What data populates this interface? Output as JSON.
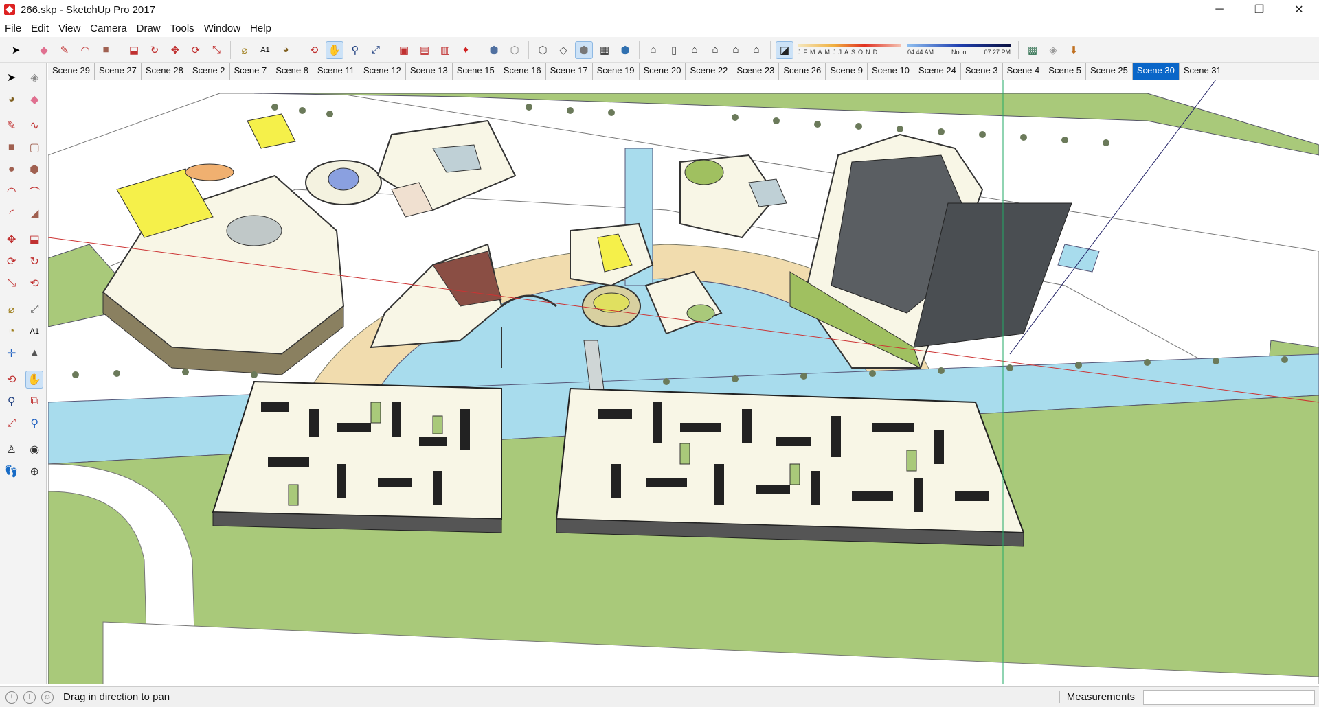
{
  "window": {
    "title": "266.skp - SketchUp Pro 2017",
    "minimize": "─",
    "maximize": "❐",
    "close": "✕"
  },
  "menu": [
    "File",
    "Edit",
    "View",
    "Camera",
    "Draw",
    "Tools",
    "Window",
    "Help"
  ],
  "toolbar": {
    "shadow_months": [
      "J",
      "F",
      "M",
      "A",
      "M",
      "J",
      "J",
      "A",
      "S",
      "O",
      "N",
      "D"
    ],
    "shadow_times": [
      "04:44 AM",
      "Noon",
      "07:27 PM"
    ],
    "icons": [
      "select-icon",
      "eraser-icon",
      "pencil-icon",
      "arc-icon",
      "rectangle-icon",
      "push-pull-icon",
      "follow-me-icon",
      "move-icon",
      "rotate-icon",
      "scale-icon",
      "tape-measure-icon",
      "text-icon",
      "paint-bucket-icon",
      "orbit-icon",
      "pan-icon",
      "zoom-icon",
      "zoom-extents-icon",
      "warehouse-icon",
      "extension-warehouse-icon",
      "layout-icon",
      "ruby-icon",
      "xray-icon",
      "back-edges-icon",
      "wireframe-icon",
      "hidden-line-icon",
      "shaded-icon",
      "shaded-textures-icon",
      "monochrome-icon",
      "iso-icon",
      "top-view-icon",
      "front-view-icon",
      "right-view-icon",
      "back-view-icon",
      "left-view-icon",
      "shadows-icon",
      "styles-icon",
      "components-icon",
      "geo-location-icon",
      "photo-textures-icon"
    ]
  },
  "scenes": {
    "tabs": [
      "Scene 29",
      "Scene 27",
      "Scene 28",
      "Scene 2",
      "Scene 7",
      "Scene 8",
      "Scene 11",
      "Scene 12",
      "Scene 13",
      "Scene 15",
      "Scene 16",
      "Scene 17",
      "Scene 19",
      "Scene 20",
      "Scene 22",
      "Scene 23",
      "Scene 26",
      "Scene 9",
      "Scene 10",
      "Scene 24",
      "Scene 3",
      "Scene 4",
      "Scene 5",
      "Scene 25",
      "Scene 30",
      "Scene 31"
    ],
    "active": "Scene 30"
  },
  "status": {
    "message": "Drag in direction to pan",
    "measurements_label": "Measurements",
    "measurements_value": ""
  },
  "colors": {
    "grass": "#a9c97a",
    "water": "#a8dced",
    "path": "#f1dcae",
    "building": "#f8f6e6",
    "accent": "#0a66c8"
  }
}
